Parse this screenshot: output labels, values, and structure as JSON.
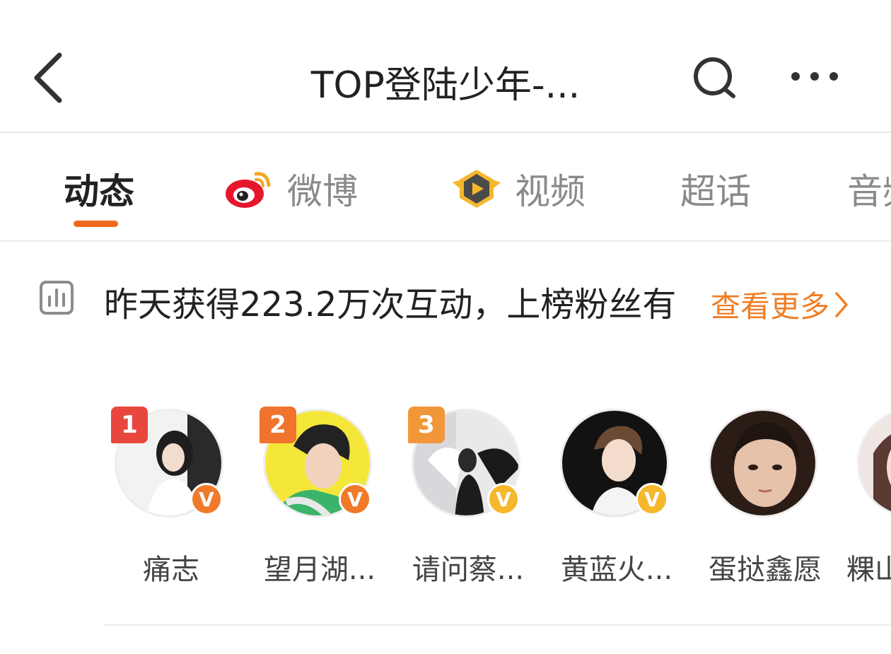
{
  "header": {
    "title": "TOP登陆少年-...",
    "back_icon": "chevron-left-icon",
    "search_icon": "search-icon",
    "more_icon": "more-horizontal-icon"
  },
  "tabs": [
    {
      "label": "动态",
      "icon": null,
      "active": true
    },
    {
      "label": "微博",
      "icon": "weibo-icon",
      "active": false
    },
    {
      "label": "视频",
      "icon": "video-play-icon",
      "active": false
    },
    {
      "label": "超话",
      "icon": null,
      "active": false
    },
    {
      "label": "音频",
      "icon": null,
      "active": false
    }
  ],
  "rank": {
    "icon": "bar-chart-icon",
    "text": "昨天获得223.2万次互动，上榜粉丝有",
    "see_more": "查看更多"
  },
  "fans": [
    {
      "name": "痛志",
      "rank": "1",
      "verified": "orange"
    },
    {
      "name": "望月湖...",
      "rank": "2",
      "verified": "orange"
    },
    {
      "name": "请问蔡...",
      "rank": "3",
      "verified": "yellow"
    },
    {
      "name": "黄蓝火...",
      "rank": null,
      "verified": "yellow"
    },
    {
      "name": "蛋挞鑫愿",
      "rank": null,
      "verified": null
    },
    {
      "name": "粿山",
      "rank": null,
      "verified": null
    }
  ],
  "colors": {
    "accent": "#f06a1d",
    "see_more": "#f07e24",
    "rank1": "#e8473e",
    "rank2": "#f0732e",
    "rank3": "#f2963a",
    "verified_orange": "#f07a2a",
    "verified_yellow": "#f5b72c"
  }
}
